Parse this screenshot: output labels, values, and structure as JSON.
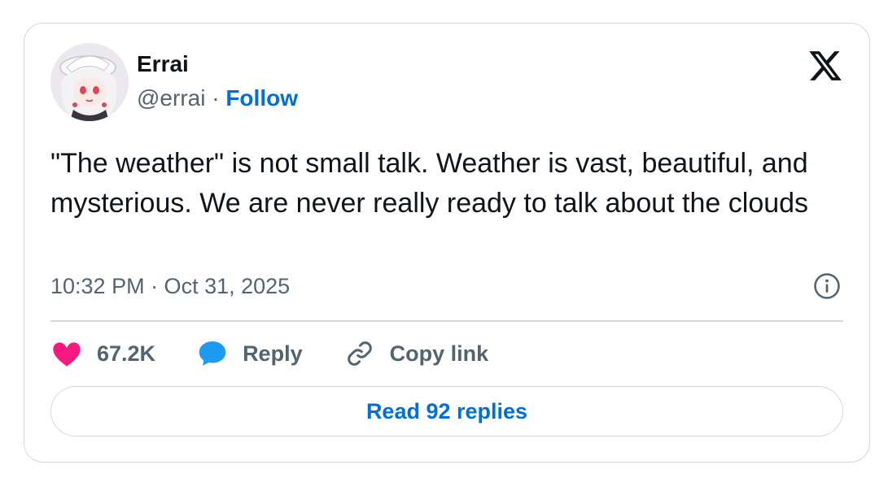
{
  "author": {
    "name": "Errai",
    "handle": "@errai",
    "separator": "·",
    "follow_label": "Follow"
  },
  "tweet": {
    "text": "\"The weather\" is not small talk. Weather is vast, beautiful, and mysterious. We are never really ready to talk about the clouds",
    "timestamp": "10:32 PM · Oct 31, 2025"
  },
  "actions": {
    "like_count": "67.2K",
    "reply_label": "Reply",
    "copy_link_label": "Copy link"
  },
  "read_replies_label": "Read 92 replies",
  "icons": {
    "brand": "x-logo-icon",
    "info": "info-icon",
    "like": "heart-icon",
    "reply": "speech-bubble-icon",
    "copy": "link-icon"
  },
  "colors": {
    "like": "#f91880",
    "reply": "#1d9bf0",
    "link": "#006fd6",
    "secondary_text": "#536471",
    "border": "#cfd9de"
  }
}
